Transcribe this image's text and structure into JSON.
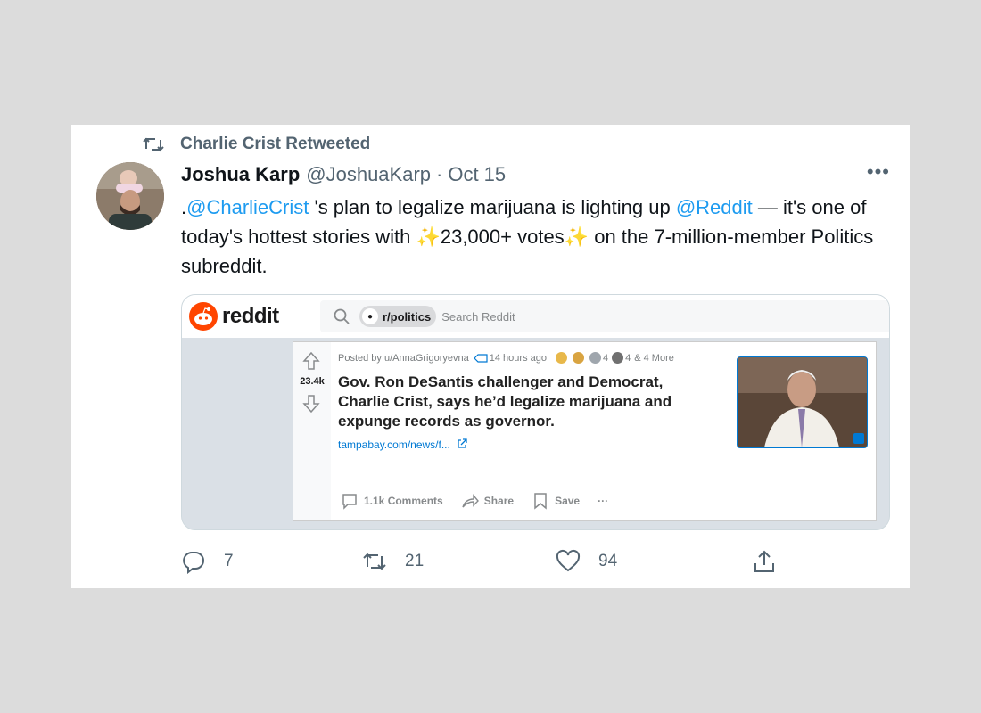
{
  "retweet": {
    "label": "Charlie Crist Retweeted"
  },
  "tweet": {
    "name": "Joshua Karp",
    "handle": "@JoshuaKarp",
    "separator": "·",
    "date": "Oct 15",
    "more": "•••",
    "text": {
      "prefix": ".",
      "mention1": "@CharlieCrist",
      "part1": " 's plan to legalize marijuana is lighting up ",
      "mention2": "@Reddit",
      "part2": " — it's one of today's hottest stories with ",
      "spark": "✨",
      "votes": "23,000+ votes",
      "part3": " on the 7-million-member Politics subreddit."
    }
  },
  "reddit": {
    "wordmark": "reddit",
    "search_chip": "r/politics",
    "search_placeholder": "Search Reddit",
    "vote_count": "23.4k",
    "meta": {
      "posted_by": "Posted by u/AnnaGrigoryevna",
      "time": "14 hours ago",
      "award_count_1": "4",
      "award_count_2": "4",
      "more_awards": "& 4 More"
    },
    "post_title": "Gov. Ron DeSantis challenger and Democrat, Charlie Crist, says he’d legalize marijuana and expunge records as governor.",
    "link": "tampabay.com/news/f...",
    "actions": {
      "comments": "1.1k Comments",
      "share": "Share",
      "save": "Save",
      "more": "···"
    }
  },
  "engagement": {
    "replies": "7",
    "retweets": "21",
    "likes": "94"
  },
  "colors": {
    "link": "#1d9bf0",
    "secondary": "#536471",
    "reddit_orange": "#ff4500",
    "reddit_blue": "#0079d3"
  }
}
